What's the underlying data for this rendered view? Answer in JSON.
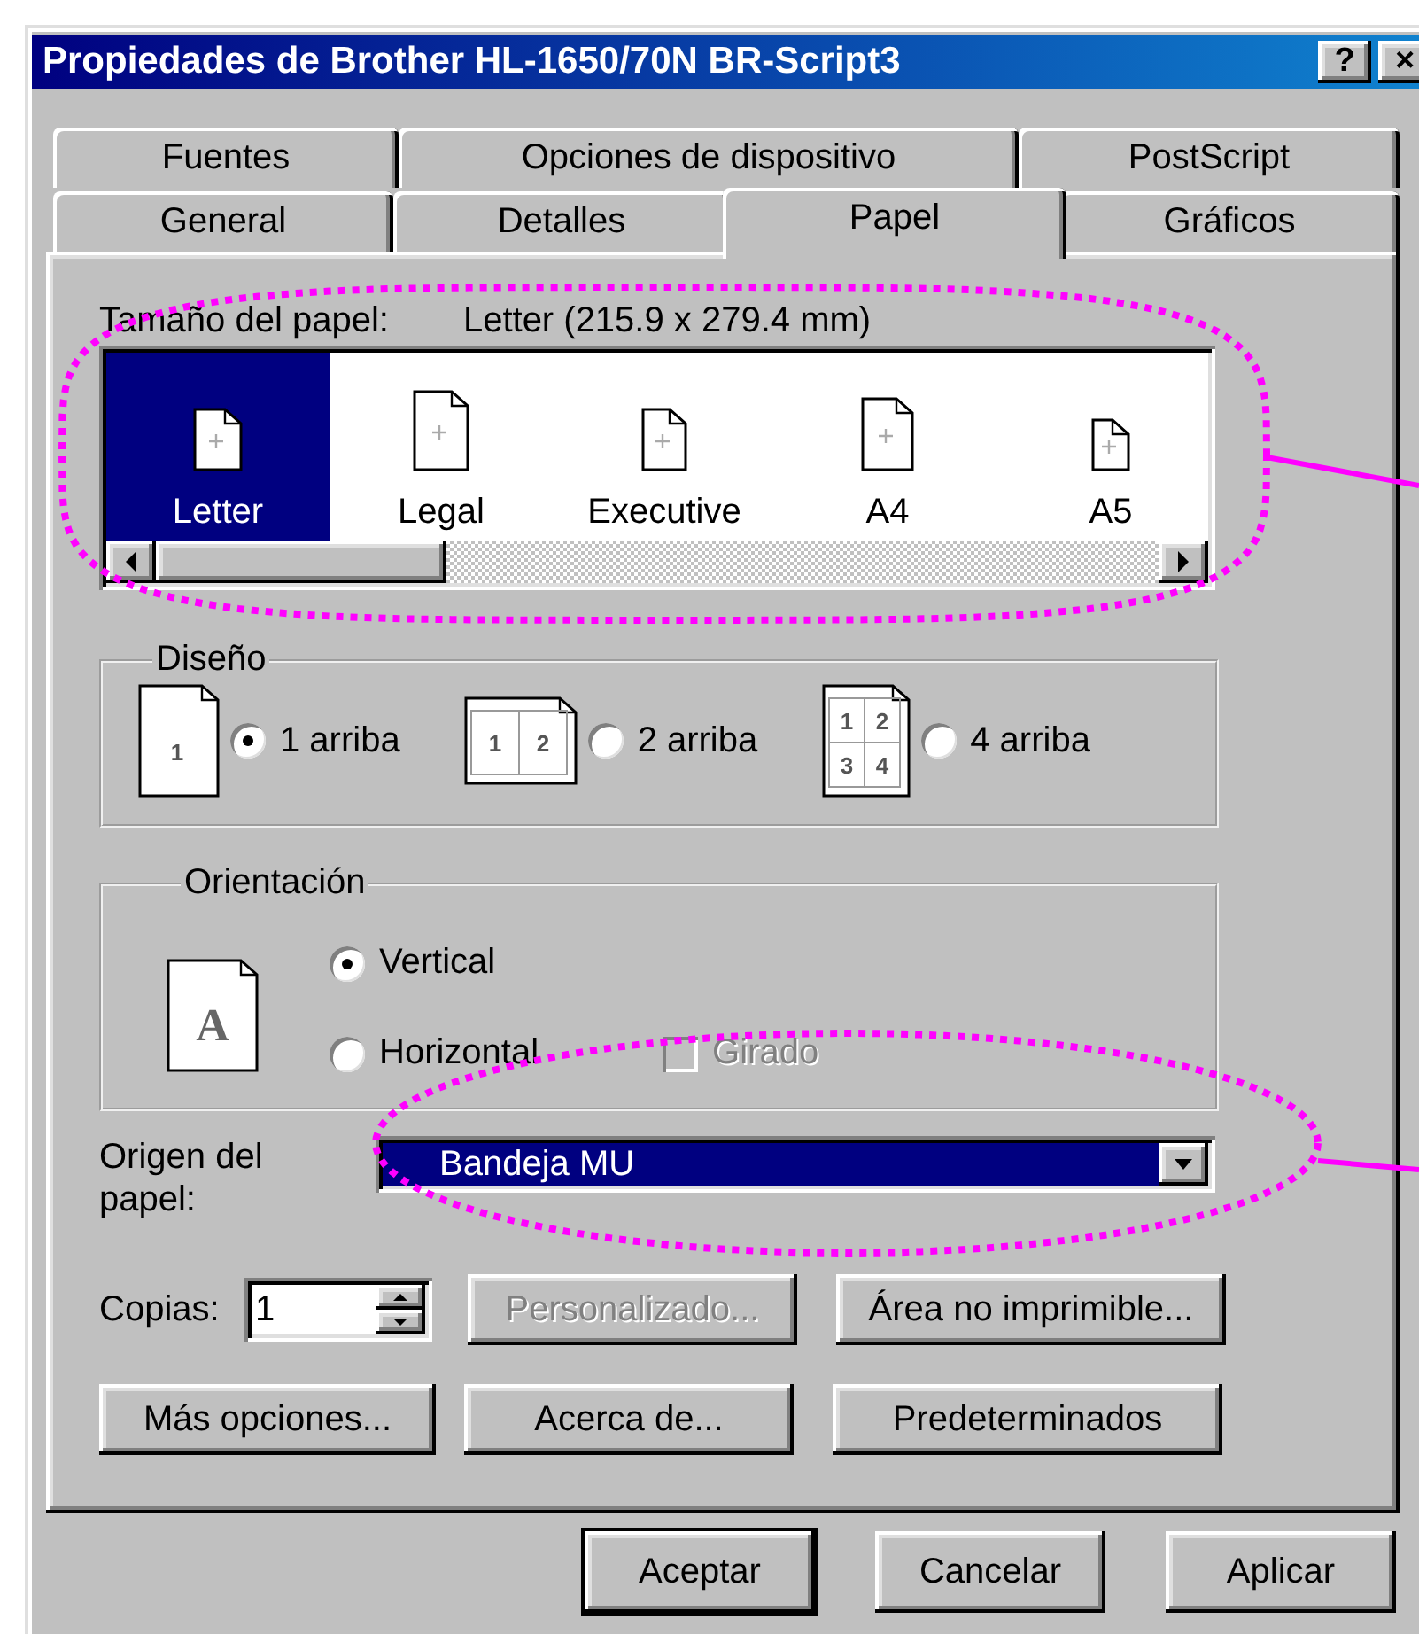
{
  "window": {
    "title": "Propiedades de Brother HL-1650/70N BR-Script3",
    "help_button": "?",
    "close_button": "×"
  },
  "tab_rows": [
    [
      {
        "label": "Fuentes",
        "selected": false
      },
      {
        "label": "Opciones de dispositivo",
        "selected": false
      },
      {
        "label": "PostScript",
        "selected": false
      }
    ],
    [
      {
        "label": "General",
        "selected": false
      },
      {
        "label": "Detalles",
        "selected": false
      },
      {
        "label": "Papel",
        "selected": true
      },
      {
        "label": "Gráficos",
        "selected": false
      }
    ]
  ],
  "paper_size": {
    "label": "Tamaño del papel:",
    "value": "Letter (215.9 x 279.4 mm)",
    "items": [
      {
        "label": "Letter",
        "selected": true
      },
      {
        "label": "Legal",
        "selected": false
      },
      {
        "label": "Executive",
        "selected": false
      },
      {
        "label": "A4",
        "selected": false
      },
      {
        "label": "A5",
        "selected": false
      }
    ]
  },
  "layout": {
    "title": "Diseño",
    "options": [
      {
        "label": "1 arriba",
        "selected": true,
        "pages": [
          "1"
        ]
      },
      {
        "label": "2 arriba",
        "selected": false,
        "pages": [
          "1",
          "2"
        ]
      },
      {
        "label": "4 arriba",
        "selected": false,
        "pages": [
          "1",
          "2",
          "3",
          "4"
        ]
      }
    ]
  },
  "orientation": {
    "title": "Orientación",
    "icon_letter": "A",
    "options": [
      {
        "label": "Vertical",
        "selected": true
      },
      {
        "label": "Horizontal",
        "selected": false
      }
    ],
    "rotated": {
      "label": "Girado",
      "checked": false,
      "disabled": true
    }
  },
  "paper_source": {
    "label": "Origen del papel:",
    "value": "Bandeja MU"
  },
  "copies": {
    "label": "Copias:",
    "value": "1"
  },
  "buttons": [
    {
      "label": "Personalizado...",
      "disabled": true
    },
    {
      "label": "Área no imprimible...",
      "disabled": false
    },
    {
      "label": "Más opciones...",
      "disabled": false
    },
    {
      "label": "Acerca de...",
      "disabled": false
    },
    {
      "label": "Predeterminados",
      "disabled": false
    }
  ],
  "dialog_buttons": [
    {
      "label": "Aceptar",
      "default": true
    },
    {
      "label": "Cancelar",
      "default": false
    },
    {
      "label": "Aplicar",
      "default": false
    }
  ],
  "callouts": [
    {
      "kind": "ellipse-with-leader"
    },
    {
      "kind": "ellipse-with-leader"
    }
  ]
}
